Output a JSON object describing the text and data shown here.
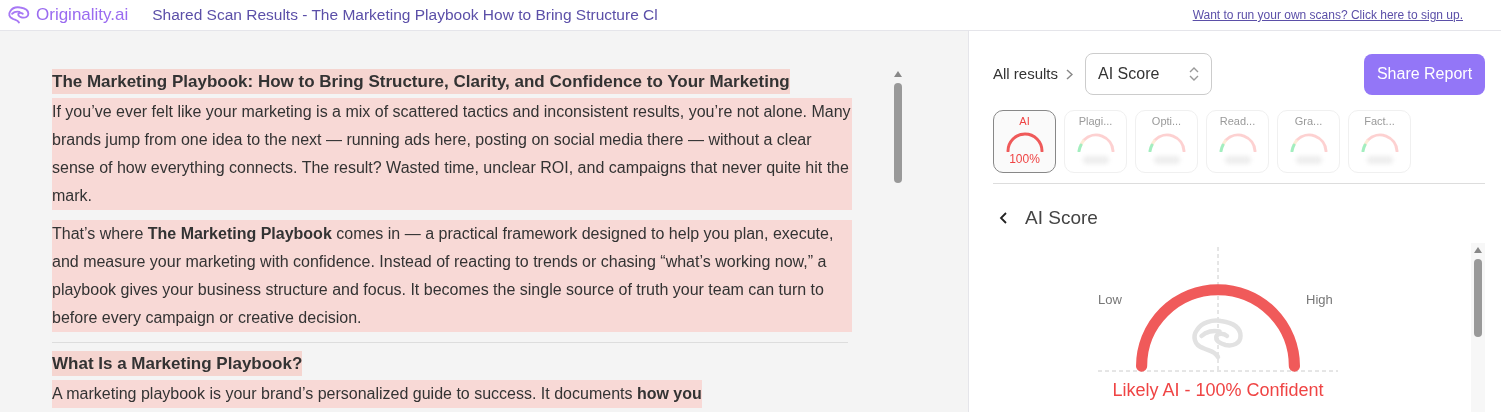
{
  "header": {
    "brand": "Originality.ai",
    "title": "Shared Scan Results - The Marketing Playbook How to Bring Structure Cl",
    "signup_link": "Want to run your own scans? Click here to sign up."
  },
  "document": {
    "blocks": [
      {
        "kind": "heading",
        "text": "The Marketing Playbook: How to Bring Structure, Clarity, and Confidence to Your Marketing"
      },
      {
        "kind": "paragraph",
        "text": "If you’ve ever felt like your marketing is a mix of scattered tactics and inconsistent results, you’re not alone. Many brands jump from one idea to the next — running ads here, posting on social media there — without a clear sense of how everything connects. The result? Wasted time, unclear ROI, and campaigns that never quite hit the mark."
      },
      {
        "kind": "paragraph",
        "text": "That’s where **The Marketing Playbook** comes in — a practical framework designed to help you plan, execute, and measure your marketing with confidence. Instead of reacting to trends or chasing “what’s working now,” a playbook gives your business structure and focus. It becomes the single source of truth your team can turn to before every campaign or creative decision."
      },
      {
        "kind": "divider"
      },
      {
        "kind": "heading",
        "text": "What Is a Marketing Playbook?"
      },
      {
        "kind": "paragraph",
        "text": "A marketing playbook is your brand’s personalized guide to success. It documents **how you**"
      }
    ]
  },
  "results": {
    "breadcrumb": "All results",
    "selector": "AI Score",
    "share_button": "Share Report",
    "tabs": [
      {
        "label": "AI",
        "value": "100%",
        "selected": true
      },
      {
        "label": "Plagi...",
        "selected": false
      },
      {
        "label": "Opti...",
        "selected": false
      },
      {
        "label": "Read...",
        "selected": false
      },
      {
        "label": "Gra...",
        "selected": false
      },
      {
        "label": "Fact...",
        "selected": false
      }
    ],
    "section_title": "AI Score",
    "gauge": {
      "low_label": "Low",
      "high_label": "High",
      "level": 1,
      "verdict": "Likely AI - 100% Confident"
    }
  }
}
